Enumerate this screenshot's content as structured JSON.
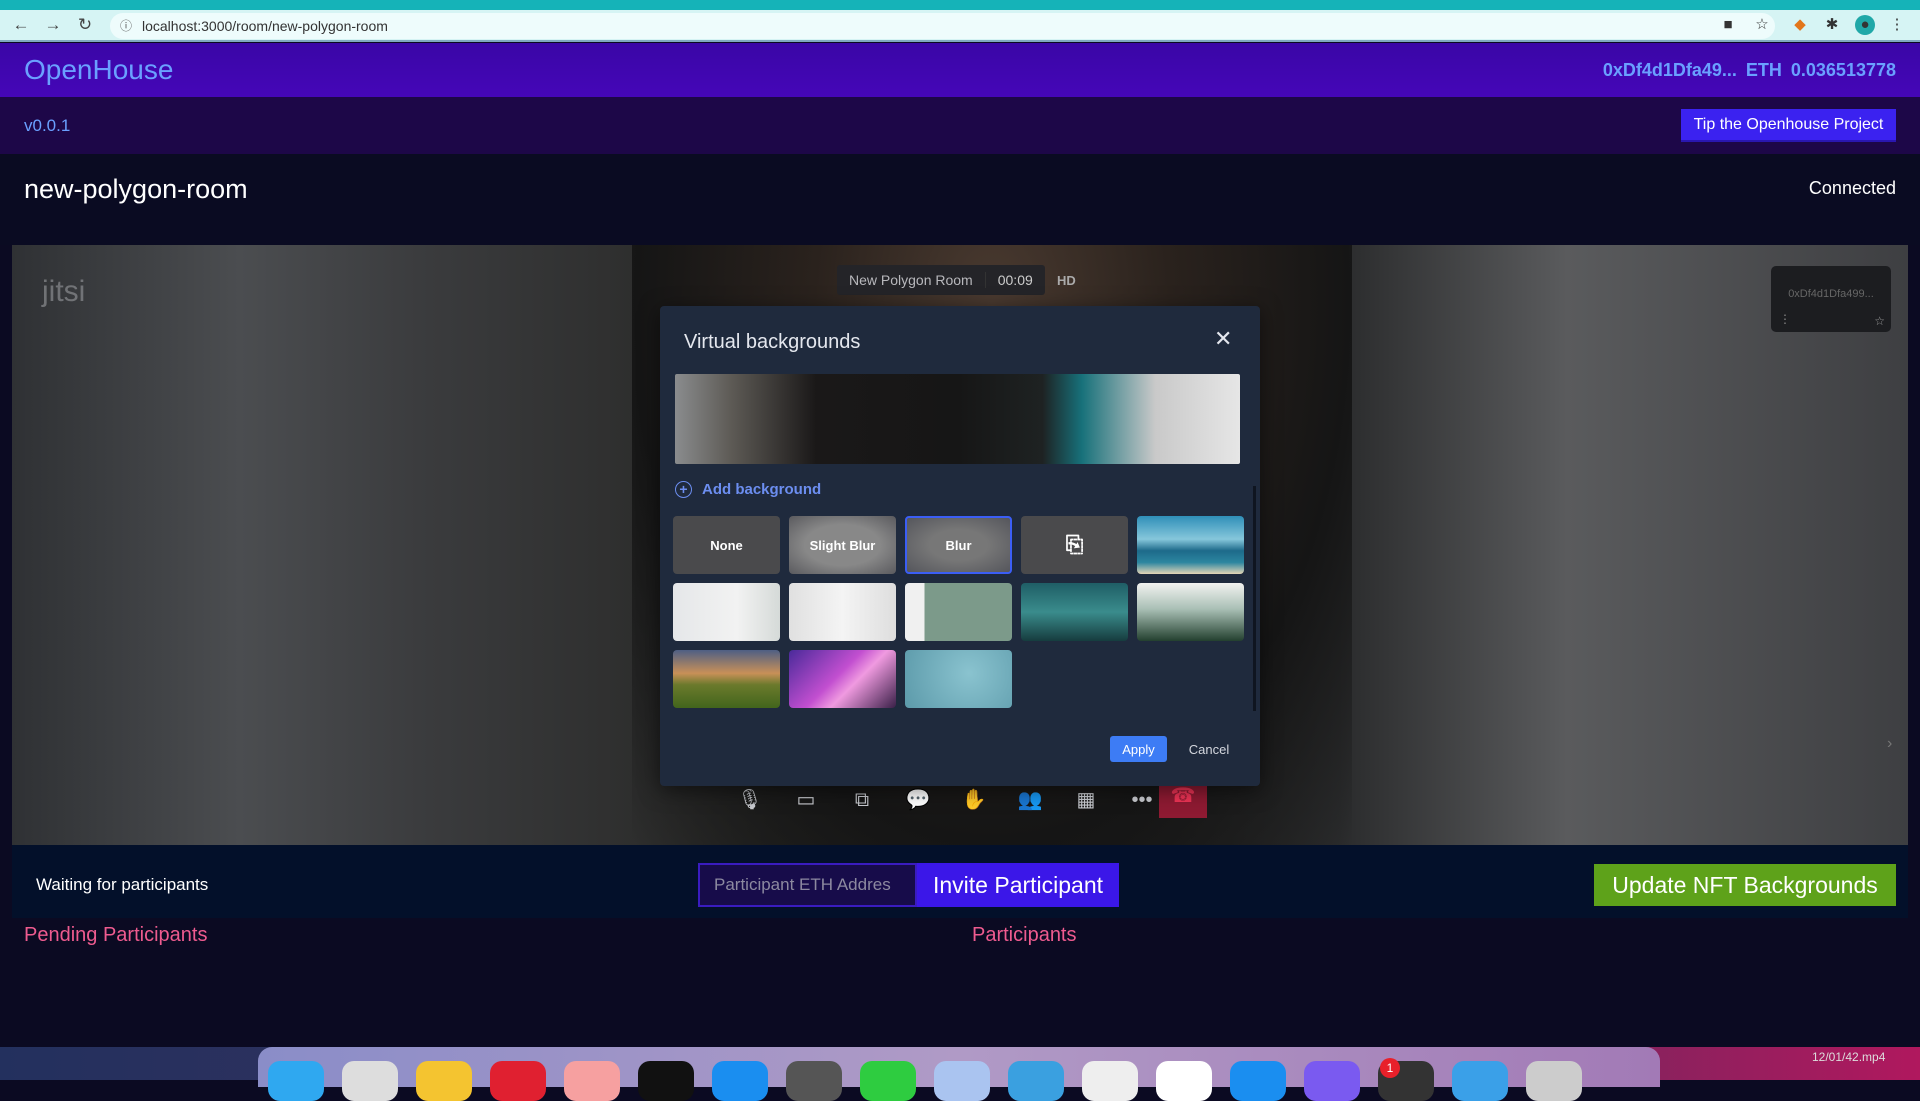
{
  "browser": {
    "url": "localhost:3000/room/new-polygon-room"
  },
  "header": {
    "logo": "OpenHouse",
    "wallet_address": "0xDf4d1Dfa49...",
    "eth_balance": "ETH 0.036513778"
  },
  "version_bar": {
    "version": "v0.0.1",
    "tip_button": "Tip the Openhouse Project"
  },
  "room": {
    "title": "new-polygon-room",
    "status": "Connected"
  },
  "jitsi": {
    "watermark": "jitsi",
    "meeting_name": "New Polygon Room",
    "timer": "00:09",
    "quality": "HD",
    "participant_thumbnail": "0xDf4d1Dfa499..."
  },
  "dialog": {
    "title": "Virtual backgrounds",
    "add_background": "Add background",
    "options": [
      {
        "label": "None",
        "kind": "none"
      },
      {
        "label": "Slight Blur",
        "kind": "slight"
      },
      {
        "label": "Blur",
        "kind": "blur",
        "selected": true
      },
      {
        "label": "",
        "kind": "share",
        "icon": "screen-share-icon"
      },
      {
        "label": "",
        "kind": "beach"
      },
      {
        "label": "",
        "kind": "room1"
      },
      {
        "label": "",
        "kind": "room2"
      },
      {
        "label": "",
        "kind": "lamp"
      },
      {
        "label": "",
        "kind": "mount"
      },
      {
        "label": "",
        "kind": "forest"
      },
      {
        "label": "",
        "kind": "sunset"
      },
      {
        "label": "",
        "kind": "purple"
      },
      {
        "label": "",
        "kind": "dots"
      }
    ],
    "apply": "Apply",
    "cancel": "Cancel"
  },
  "bottom": {
    "waiting": "Waiting for participants",
    "eth_placeholder": "Participant ETH Addres",
    "invite": "Invite Participant",
    "update_nft": "Update NFT Backgrounds"
  },
  "sections": {
    "pending": "Pending Participants",
    "participants": "Participants"
  },
  "dock": {
    "badge": "1",
    "recording_label": "12/01/42.mp4"
  },
  "colors": {
    "header": "#4506b8",
    "invite": "#3b17e8",
    "update_nft": "#5ea21a",
    "section_title": "#ee5b8f",
    "apply": "#3d7cf5"
  }
}
